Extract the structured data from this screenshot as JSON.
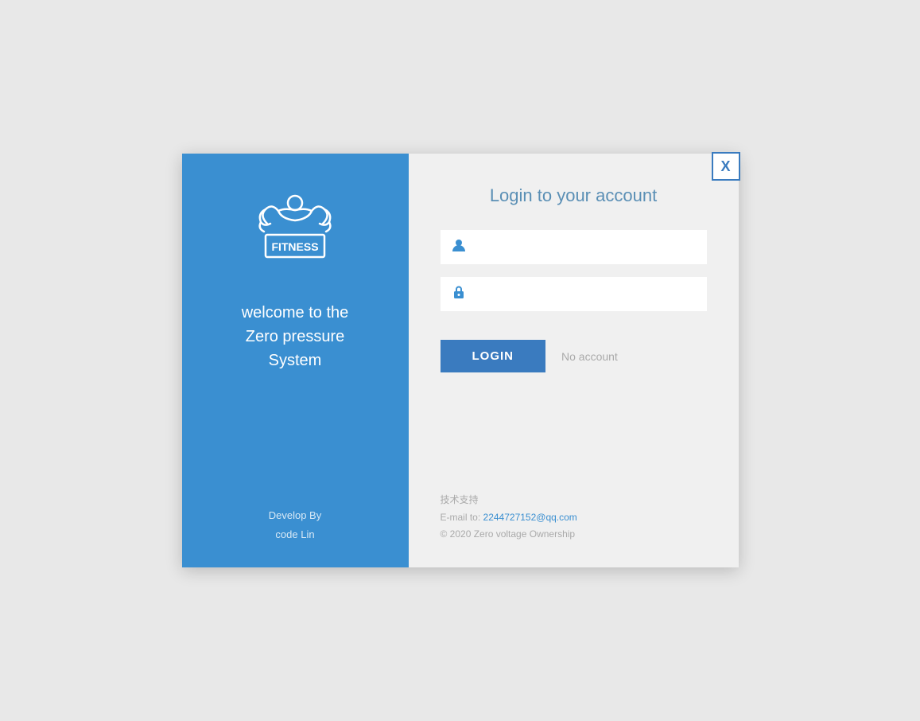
{
  "app": {
    "background_color": "#e8e8e8"
  },
  "close_button": {
    "label": "X"
  },
  "left_panel": {
    "welcome_line1": "welcome to the",
    "welcome_line2": "Zero pressure",
    "welcome_line3": "System",
    "dev_label": "Develop By",
    "dev_name": "code Lin"
  },
  "right_panel": {
    "title": "Login to your account",
    "username_placeholder": "",
    "password_placeholder": "",
    "login_button": "LOGIN",
    "no_account_text": "No account"
  },
  "footer": {
    "tech_support": "技术支持",
    "email_label": "E-mail to:",
    "email": "2244727152@qq.com",
    "copyright": "© 2020  Zero voltage Ownership"
  }
}
